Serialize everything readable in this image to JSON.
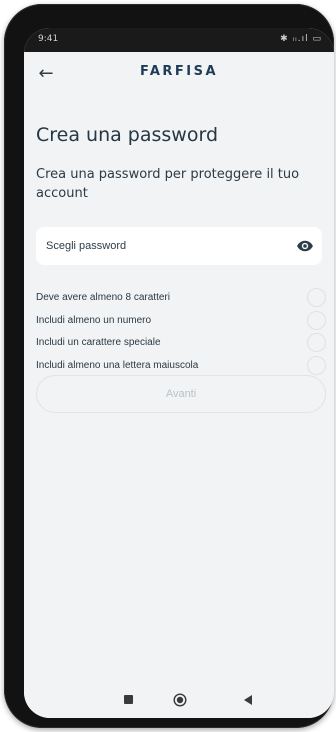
{
  "status_bar": {
    "time": "9:41",
    "indicators": "✱ ᵢᵢ.ıl ▭"
  },
  "app_bar": {
    "back_icon": "arrow-left-icon",
    "brand": "FARFISA"
  },
  "page": {
    "title": "Crea una password",
    "subtitle": "Crea una password per proteggere il tuo account"
  },
  "password_field": {
    "placeholder": "Scegli password",
    "value": "",
    "toggle_icon": "eye-icon"
  },
  "requirements": [
    {
      "label": "Deve avere almeno 8 caratteri",
      "met": false
    },
    {
      "label": "Includi almeno un numero",
      "met": false
    },
    {
      "label": "Includi un carattere speciale",
      "met": false
    },
    {
      "label": "Includi almeno una lettera maiuscola",
      "met": false
    }
  ],
  "next_button": {
    "label": "Avanti",
    "enabled": false
  },
  "nav_bar": {
    "icons": [
      "recents-icon",
      "home-icon",
      "back-icon"
    ]
  },
  "colors": {
    "brand": "#1f3b57",
    "text": "#243746",
    "background": "#f1f3f4",
    "disabled": "#b9c2c8"
  }
}
